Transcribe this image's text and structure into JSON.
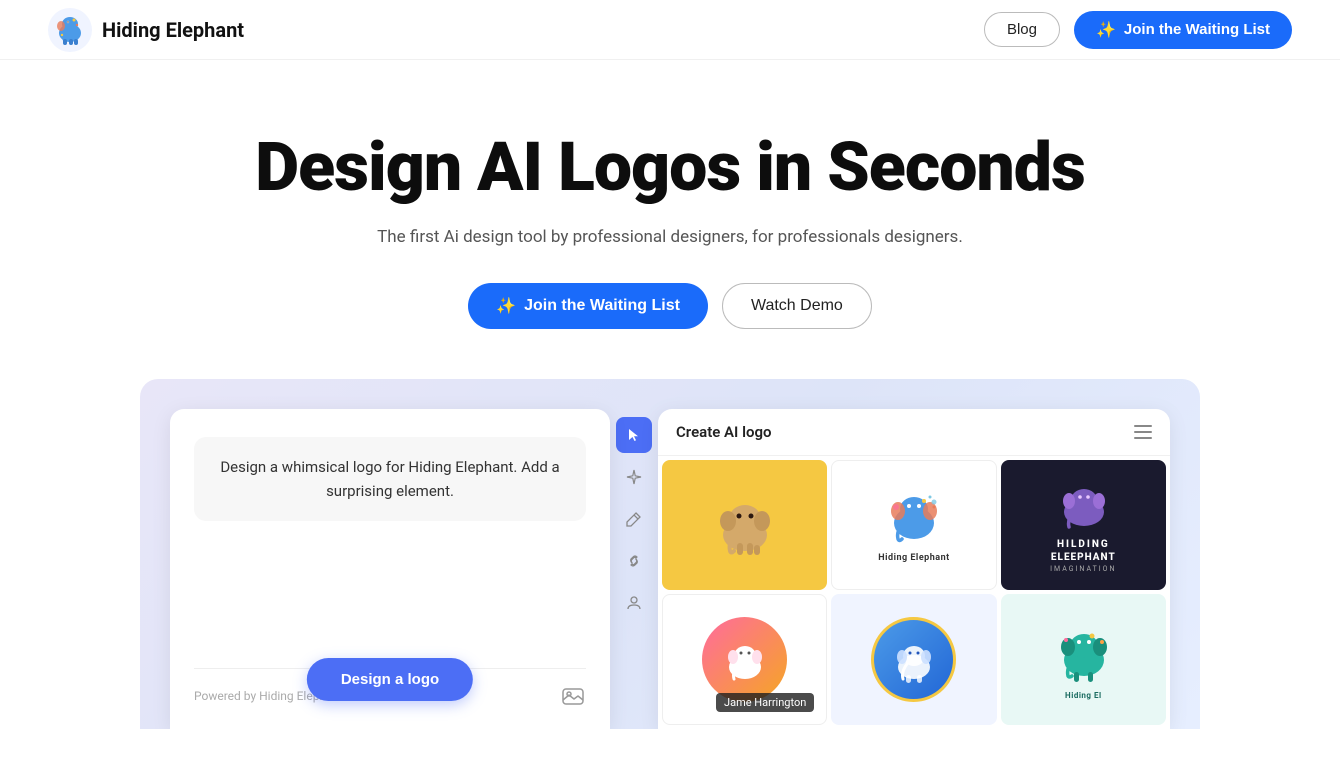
{
  "nav": {
    "logo_text": "Hiding Elephant",
    "blog_label": "Blog",
    "waitlist_label": "Join the Waiting List"
  },
  "hero": {
    "title": "Design AI Logos in Seconds",
    "subtitle": "The first Ai design tool by professional designers, for professionals designers.",
    "waitlist_button": "Join the Waiting List",
    "demo_button": "Watch Demo"
  },
  "app_preview": {
    "chat_panel": {
      "chat_text": "Design a whimsical logo for Hiding Elephant. Add a surprising element.",
      "powered_by": "Powered by Hiding Elephant",
      "design_button": "Design a logo"
    },
    "right_panel": {
      "title": "Create AI logo",
      "logo_cells": [
        {
          "id": 1,
          "bg": "#f5c842",
          "label": ""
        },
        {
          "id": 2,
          "bg": "#ffffff",
          "label": "Hiding Elephant"
        },
        {
          "id": 3,
          "bg": "#1a1a2e",
          "label": "HILDING ELEEPHANT"
        },
        {
          "id": 4,
          "bg": "#ffffff",
          "label": ""
        },
        {
          "id": 5,
          "bg": "#e8eeff",
          "label": ""
        },
        {
          "id": 6,
          "bg": "#e0f5f5",
          "label": "Hiding El"
        }
      ],
      "tooltip": "Jame Harrington"
    }
  }
}
